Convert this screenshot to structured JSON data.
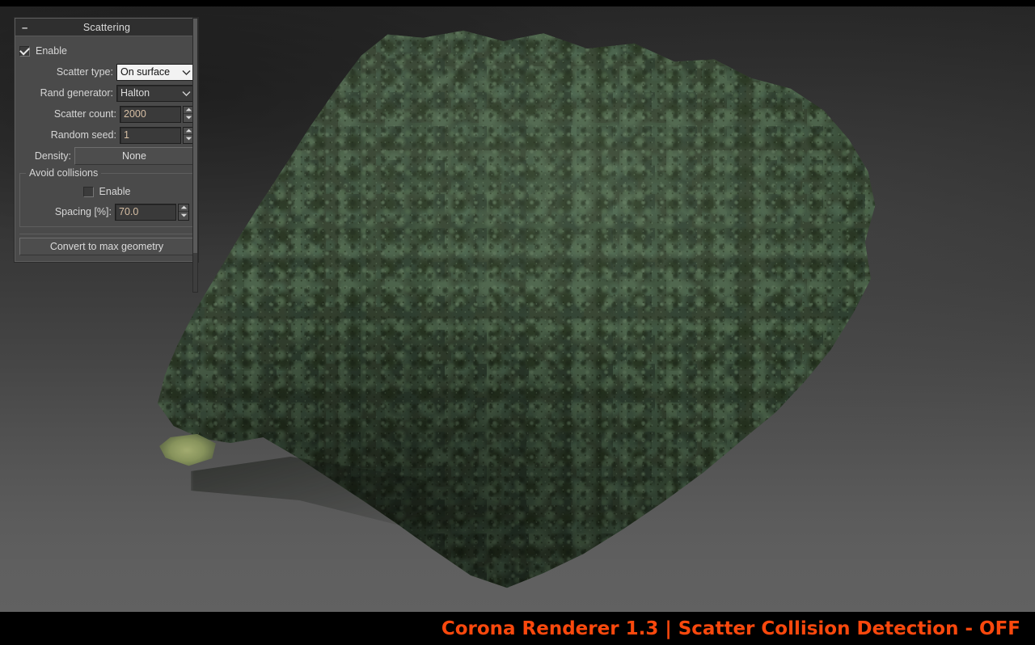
{
  "app": {
    "viewport_label": "3d-render-viewport"
  },
  "panel": {
    "rollout": {
      "collapse_glyph": "–",
      "title": "Scattering"
    },
    "enable": {
      "label": "Enable",
      "checked": true
    },
    "scatter_type": {
      "label": "Scatter type:",
      "value": "On surface",
      "focused": true
    },
    "rand_generator": {
      "label": "Rand generator:",
      "value": "Halton",
      "focused": false
    },
    "scatter_count": {
      "label": "Scatter count:",
      "value": "2000"
    },
    "random_seed": {
      "label": "Random seed:",
      "value": "1"
    },
    "density": {
      "label": "Density:",
      "value": "None"
    },
    "avoid_collisions": {
      "title": "Avoid collisions",
      "enable": {
        "label": "Enable",
        "checked": false
      },
      "spacing": {
        "label": "Spacing [%]:",
        "value": "70.0"
      }
    },
    "convert_button": {
      "label": "Convert to max geometry"
    }
  },
  "caption": {
    "text": "Corona  Renderer 1.3 | Scatter Collision Detection - OFF",
    "color": "#f9480d",
    "background": "#000000"
  },
  "scene": {
    "description": "dense dark-green forest canopy scattered on a square terrain plane",
    "canopy_color": "#34412f",
    "ground_patch_color": "#8d9a5e",
    "background_top": "#262626",
    "background_bottom": "#616161"
  }
}
